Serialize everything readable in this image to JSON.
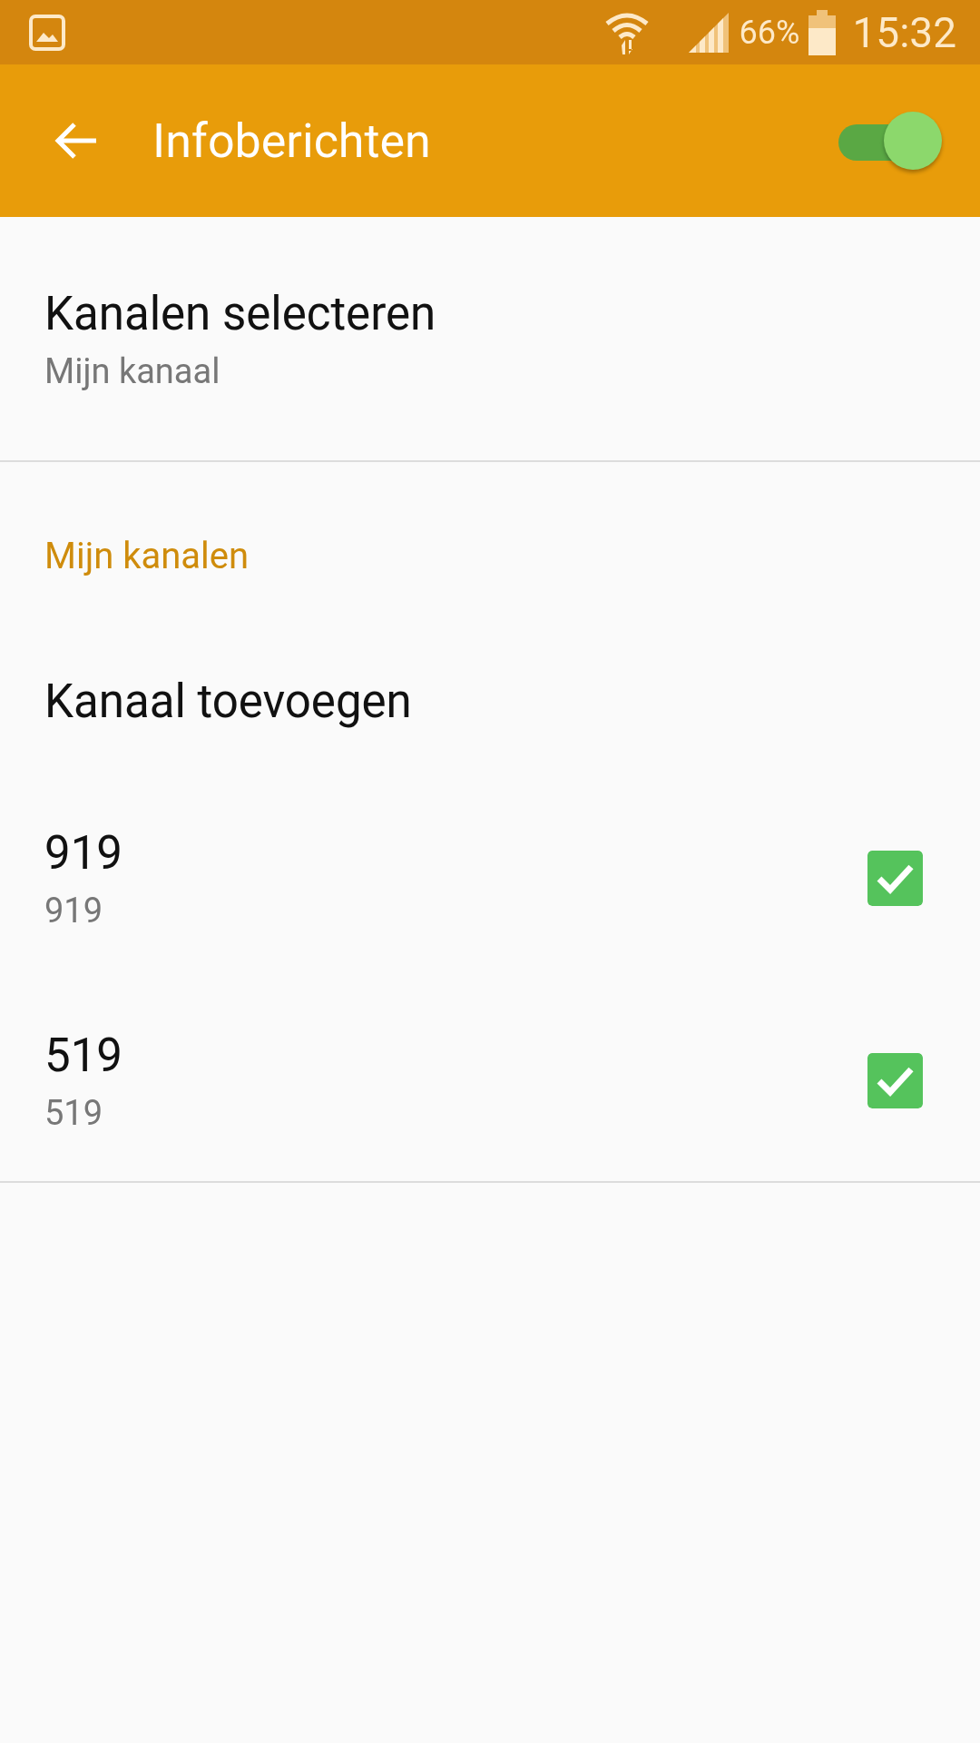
{
  "status_bar": {
    "battery": "66%",
    "time": "15:32"
  },
  "app_bar": {
    "title": "Infoberichten",
    "switch_on": true
  },
  "settings": [
    {
      "title": "Kanalen selecteren",
      "subtitle": "Mijn kanaal"
    }
  ],
  "section": {
    "header": "Mijn kanalen",
    "items": [
      {
        "kind": "action",
        "title": "Kanaal toevoegen"
      },
      {
        "kind": "channel",
        "title": "919",
        "subtitle": "919",
        "checked": true
      },
      {
        "kind": "channel",
        "title": "519",
        "subtitle": "519",
        "checked": true
      }
    ]
  }
}
